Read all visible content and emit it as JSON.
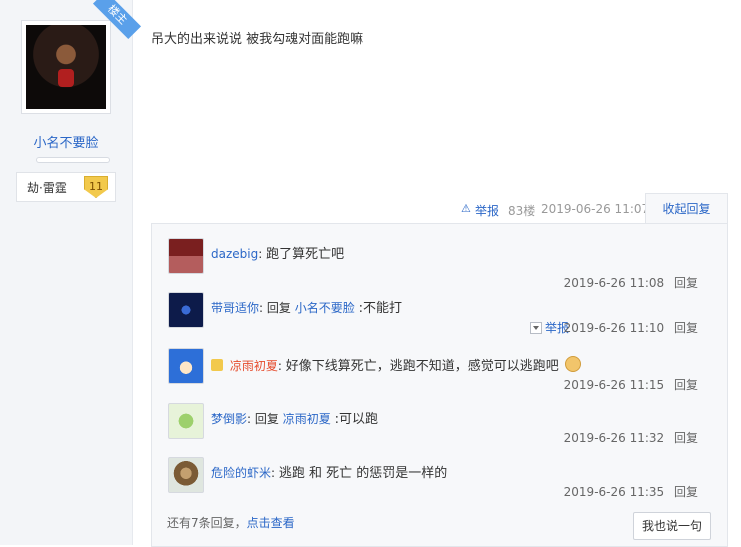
{
  "post": {
    "owner_badge": "楼主",
    "username": "小名不要脸",
    "level_name": "劫·雷霆",
    "level": "11",
    "content": "吊大的出来说说 被我勾魂对面能跑嘛",
    "report": "举报",
    "floor": "83楼",
    "time": "2019-06-26 11:07",
    "collapse": "收起回复"
  },
  "replies": [
    {
      "user": "dazebig",
      "text": "跑了算死亡吧",
      "time": "2019-6-26 11:08",
      "reply": "回复"
    },
    {
      "user": "带哥适你",
      "prefix": "回复",
      "target": "小名不要脸",
      "text": ":不能打",
      "report": "举报",
      "time": "2019-6-26 11:10",
      "reply": "回复"
    },
    {
      "user": "凉雨初夏",
      "text": "好像下线算死亡，逃跑不知道，感觉可以逃跑吧",
      "time": "2019-6-26 11:15",
      "reply": "回复"
    },
    {
      "user": "梦倒影",
      "prefix": "回复",
      "target": "凉雨初夏",
      "text": ":可以跑",
      "time": "2019-6-26 11:32",
      "reply": "回复"
    },
    {
      "user": "危险的虾米",
      "text": "逃跑 和 死亡 的惩罚是一样的",
      "time": "2019-6-26 11:35",
      "reply": "回复"
    }
  ],
  "more": {
    "text": "还有7条回复，",
    "link": "点击查看"
  },
  "say_button": "我也说一句"
}
